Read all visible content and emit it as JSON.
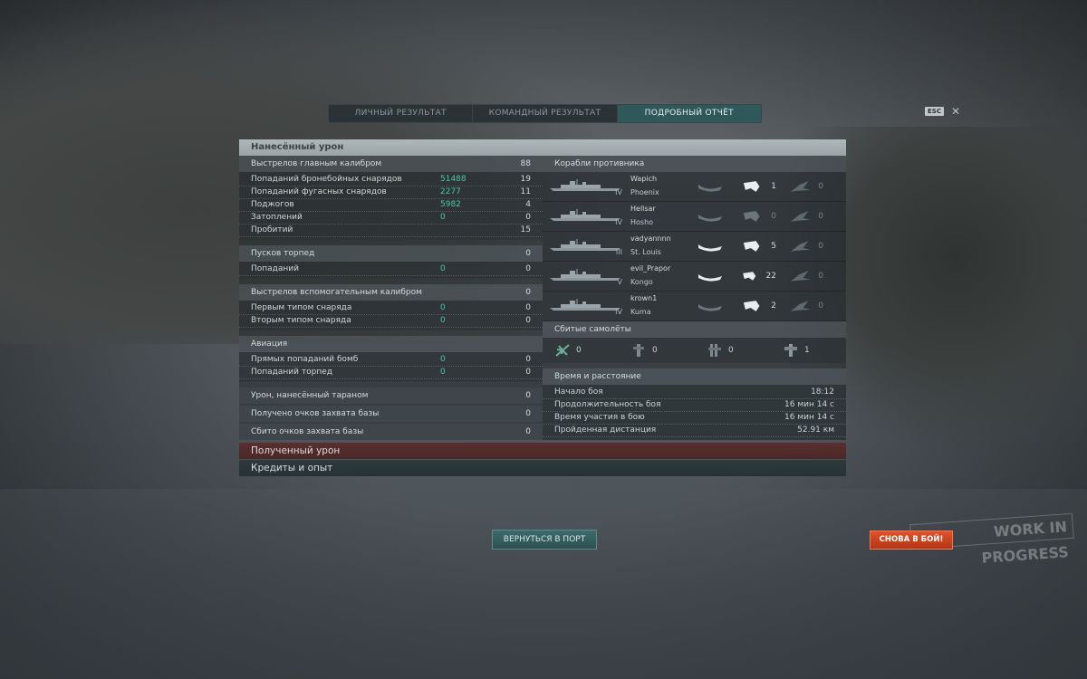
{
  "tabs": [
    "ЛИЧНЫЙ РЕЗУЛЬТАТ",
    "КОМАНДНЫЙ РЕЗУЛЬТАТ",
    "ПОДРОБНЫЙ ОТЧЁТ"
  ],
  "active_tab": 2,
  "esc": {
    "key": "ESC",
    "close": "✕"
  },
  "damage": {
    "title": "Нанесённый урон",
    "main_battery": {
      "label": "Выстрелов главным калибром",
      "value": "88",
      "rows": [
        {
          "label": "Попаданий бронебойных снарядов",
          "sub": "51488",
          "value": "19"
        },
        {
          "label": "Попаданий фугасных снарядов",
          "sub": "2277",
          "value": "11"
        },
        {
          "label": "Поджогов",
          "sub": "5982",
          "value": "4"
        },
        {
          "label": "Затоплений",
          "sub": "0",
          "value": "0"
        },
        {
          "label": "Пробитий",
          "sub": "",
          "value": "15"
        }
      ]
    },
    "torpedoes": {
      "label": "Пусков торпед",
      "value": "0",
      "rows": [
        {
          "label": "Попаданий",
          "sub": "0",
          "value": "0"
        }
      ]
    },
    "secondary": {
      "label": "Выстрелов вспомогательным калибром",
      "value": "0",
      "rows": [
        {
          "label": "Первым типом снаряда",
          "sub": "0",
          "value": "0"
        },
        {
          "label": "Вторым типом снаряда",
          "sub": "0",
          "value": "0"
        }
      ]
    },
    "aviation": {
      "label": "Авиация",
      "rows": [
        {
          "label": "Прямых попаданий бомб",
          "sub": "0",
          "value": "0"
        },
        {
          "label": "Попаданий торпед",
          "sub": "0",
          "value": "0"
        }
      ]
    },
    "ram": {
      "label": "Урон, нанесённый тараном",
      "value": "0"
    },
    "capture": {
      "label": "Получено очков захвата базы",
      "value": "0"
    },
    "defend": {
      "label": "Сбито очков захвата базы",
      "value": "0"
    }
  },
  "enemy": {
    "title": "Корабли противника",
    "ships": [
      {
        "player": "Wapich",
        "name": "Phoenix",
        "tier": "IV",
        "hits": "",
        "kills": "1",
        "planes": "0",
        "hits_active": false
      },
      {
        "player": "Hellsar",
        "name": "Hosho",
        "tier": "IV",
        "hits": "",
        "kills": "0",
        "planes": "0",
        "hits_active": false
      },
      {
        "player": "vadyannnn",
        "name": "St. Louis",
        "tier": "III",
        "hits": "",
        "kills": "5",
        "planes": "0",
        "hits_active": true
      },
      {
        "player": "evil_Prapor",
        "name": "Kongo",
        "tier": "V",
        "hits": "",
        "kills": "22",
        "planes": "0",
        "hits_active": true
      },
      {
        "player": "krown1",
        "name": "Kuma",
        "tier": "IV",
        "hits": "",
        "kills": "2",
        "planes": "0",
        "hits_active": false
      }
    ]
  },
  "planes_down": {
    "title": "Сбитые самолёты",
    "items": [
      {
        "icon": "fighter-icon",
        "value": "0"
      },
      {
        "icon": "torpedo-bomber-icon",
        "value": "0"
      },
      {
        "icon": "dive-bomber-icon",
        "value": "0"
      },
      {
        "icon": "scout-plane-icon",
        "value": "1"
      }
    ]
  },
  "time": {
    "title": "Время и расстояние",
    "rows": [
      {
        "label": "Начало боя",
        "value": "18:12"
      },
      {
        "label": "Продолжительность боя",
        "value": "16 мин 14 с"
      },
      {
        "label": "Время участия в бою",
        "value": "16 мин 14 с"
      },
      {
        "label": "Пройденная дистанция",
        "value": "52.91 км"
      }
    ]
  },
  "received": "Полученный урон",
  "credits": "Кредиты и опыт",
  "buttons": {
    "port": "ВЕРНУТЬСЯ В ПОРТ",
    "battle": "СНОВА В БОЙ!"
  },
  "watermark": "WORK IN PROGRESS",
  "colors": {
    "accent": "#4ec5a7",
    "tab_active": "#2f5859",
    "battle_button": "#d0451f"
  }
}
